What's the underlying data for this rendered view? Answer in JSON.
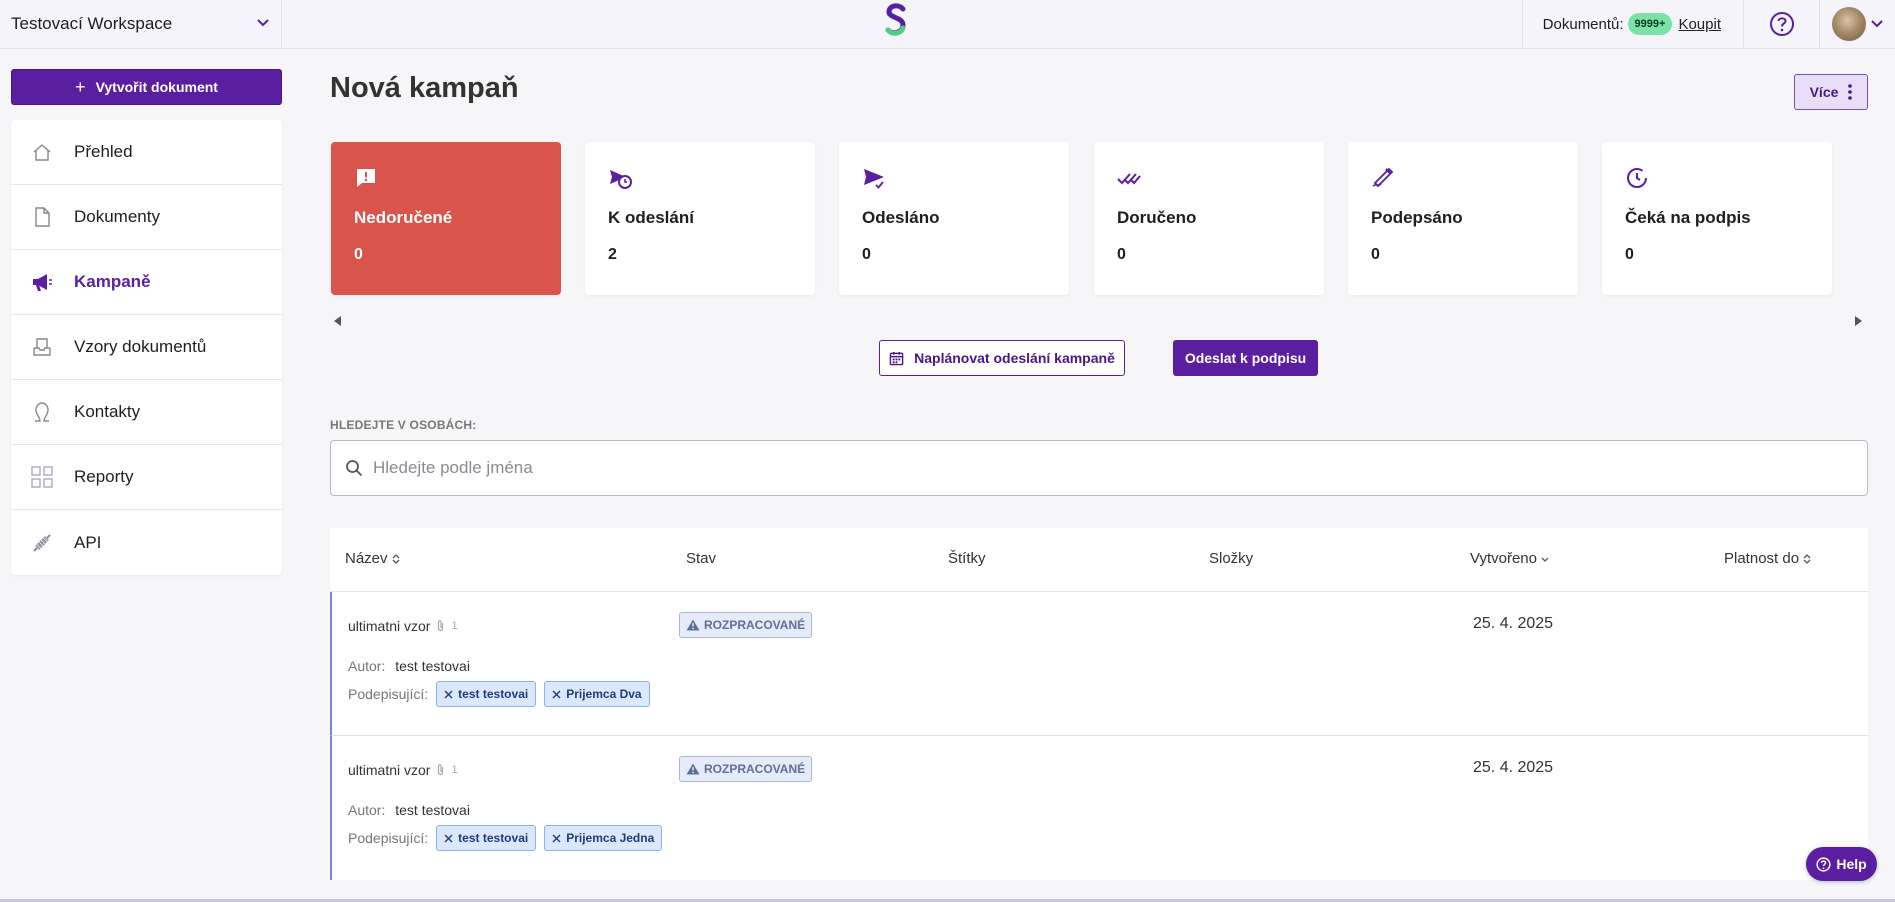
{
  "colors": {
    "brand": "#5a1fa0",
    "undelivered": "#d9544a",
    "brand_light": "#e9def7"
  },
  "topbar": {
    "workspace": "Testovací Workspace",
    "documents_label": "Dokumentů:",
    "documents_count": "9999+",
    "buy_link": "Koupit"
  },
  "sidebar": {
    "create_button": "Vytvořit dokument",
    "items": [
      {
        "label": "Přehled",
        "icon": "home-icon"
      },
      {
        "label": "Dokumenty",
        "icon": "document-icon"
      },
      {
        "label": "Kampaně",
        "icon": "megaphone-icon",
        "active": true
      },
      {
        "label": "Vzory dokumentů",
        "icon": "template-icon"
      },
      {
        "label": "Kontakty",
        "icon": "contact-icon"
      },
      {
        "label": "Reporty",
        "icon": "grid-icon"
      },
      {
        "label": "API",
        "icon": "plug-icon"
      }
    ]
  },
  "main": {
    "title": "Nová kampaň",
    "more_button": "Více",
    "cards": [
      {
        "label": "Nedoručené",
        "value": "0",
        "icon": "alert-message-icon"
      },
      {
        "label": "K odeslání",
        "value": "2",
        "icon": "send-clock-icon"
      },
      {
        "label": "Odesláno",
        "value": "0",
        "icon": "send-icon"
      },
      {
        "label": "Doručeno",
        "value": "0",
        "icon": "double-check-icon"
      },
      {
        "label": "Podepsáno",
        "value": "0",
        "icon": "signature-icon"
      },
      {
        "label": "Čeká na podpis",
        "value": "0",
        "icon": "clock-icon"
      }
    ],
    "schedule_button": "Naplánovat odeslání kampaně",
    "send_button": "Odeslat k podpisu",
    "search": {
      "label": "HLEDEJTE V OSOBÁCH:",
      "placeholder": "Hledejte podle jména"
    },
    "table": {
      "columns": [
        "Název",
        "Stav",
        "Štítky",
        "Složky",
        "Vytvořeno",
        "Platnost do"
      ],
      "rows": [
        {
          "name": "ultimatni vzor",
          "attachments": "1",
          "status": "ROZPRACOVANÉ",
          "created": "25. 4. 2025",
          "author_label": "Autor:",
          "author": "test testovai",
          "signers_label": "Podepisující:",
          "signers": [
            "test testovai",
            "Prijemca Dva"
          ]
        },
        {
          "name": "ultimatni vzor",
          "attachments": "1",
          "status": "ROZPRACOVANÉ",
          "created": "25. 4. 2025",
          "author_label": "Autor:",
          "author": "test testovai",
          "signers_label": "Podepisující:",
          "signers": [
            "test testovai",
            "Prijemca Jedna"
          ]
        }
      ]
    }
  },
  "help_button": "Help"
}
